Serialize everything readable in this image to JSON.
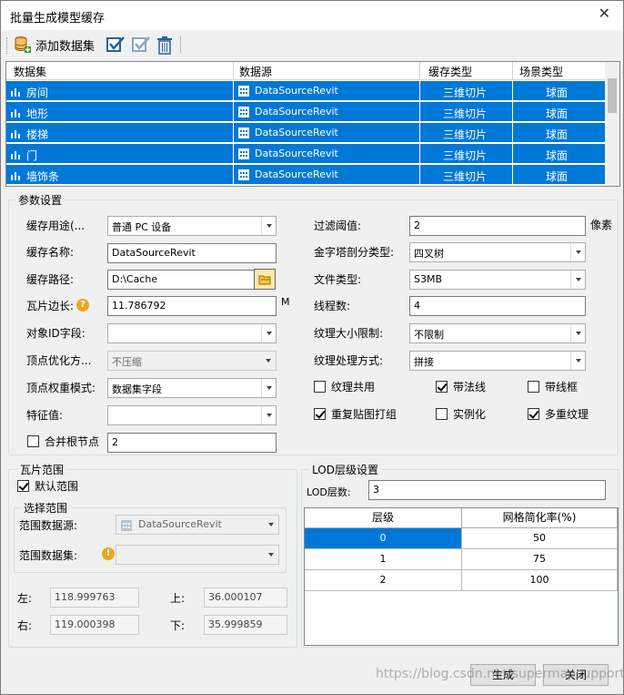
{
  "window": {
    "title": "批量生成模型缓存"
  },
  "toolbar": {
    "add_label": "添加数据集"
  },
  "grid": {
    "headers": [
      "数据集",
      "数据源",
      "缓存类型",
      "场景类型"
    ],
    "rows": [
      {
        "dataset": "房间",
        "source": "DataSourceRevit",
        "cache": "三维切片",
        "scene": "球面"
      },
      {
        "dataset": "地形",
        "source": "DataSourceRevit",
        "cache": "三维切片",
        "scene": "球面"
      },
      {
        "dataset": "楼梯",
        "source": "DataSourceRevit",
        "cache": "三维切片",
        "scene": "球面"
      },
      {
        "dataset": "门",
        "source": "DataSourceRevit",
        "cache": "三维切片",
        "scene": "球面"
      },
      {
        "dataset": "墙饰条",
        "source": "DataSourceRevit",
        "cache": "三维切片",
        "scene": "球面"
      }
    ]
  },
  "params": {
    "legend": "参数设置",
    "usage_label": "缓存用途(...",
    "usage_value": "普通 PC 设备",
    "name_label": "缓存名称:",
    "name_value": "DataSourceRevit",
    "path_label": "缓存路径:",
    "path_value": "D:\\Cache",
    "tile_label": "瓦片边长:",
    "tile_value": "11.786792",
    "tile_unit": "M",
    "objid_label": "对象ID字段:",
    "objid_value": "",
    "vertex_opt_label": "顶点优化方...",
    "vertex_opt_value": "不压缩",
    "vertex_weight_label": "顶点权重模式:",
    "vertex_weight_value": "数据集字段",
    "feature_label": "特征值:",
    "feature_value": "",
    "merge_label": "合并根节点",
    "merge_value": "2",
    "filter_label": "过滤阈值:",
    "filter_value": "2",
    "filter_unit": "像素",
    "pyramid_label": "金字塔剖分类型:",
    "pyramid_value": "四叉树",
    "filetype_label": "文件类型:",
    "filetype_value": "S3MB",
    "threads_label": "线程数:",
    "threads_value": "4",
    "texsize_label": "纹理大小限制:",
    "texsize_value": "不限制",
    "texproc_label": "纹理处理方式:",
    "texproc_value": "拼接",
    "cb_texshare": "纹理共用",
    "cb_normal": "带法线",
    "cb_wireframe": "带线框",
    "cb_repack": "重复贴图打组",
    "cb_instance": "实例化",
    "cb_multitex": "多重纹理"
  },
  "tile_range": {
    "legend": "瓦片范围",
    "default_label": "默认范围",
    "select_legend": "选择范围",
    "src_label": "范围数据源:",
    "src_value": "DataSourceRevit",
    "ds_label": "范围数据集:",
    "left_label": "左:",
    "left_value": "118.999763",
    "top_label": "上:",
    "top_value": "36.000107",
    "right_label": "右:",
    "right_value": "119.000398",
    "bottom_label": "下:",
    "bottom_value": "35.999859"
  },
  "lod": {
    "legend": "LOD层级设置",
    "count_label": "LOD层数:",
    "count_value": "3",
    "headers": [
      "层级",
      "网格简化率(%)"
    ],
    "rows": [
      {
        "level": "0",
        "rate": "50"
      },
      {
        "level": "1",
        "rate": "75"
      },
      {
        "level": "2",
        "rate": "100"
      }
    ]
  },
  "buttons": {
    "generate": "生成",
    "close": "关闭"
  },
  "watermark": "https://blog.csdn.net/supermapsupport"
}
